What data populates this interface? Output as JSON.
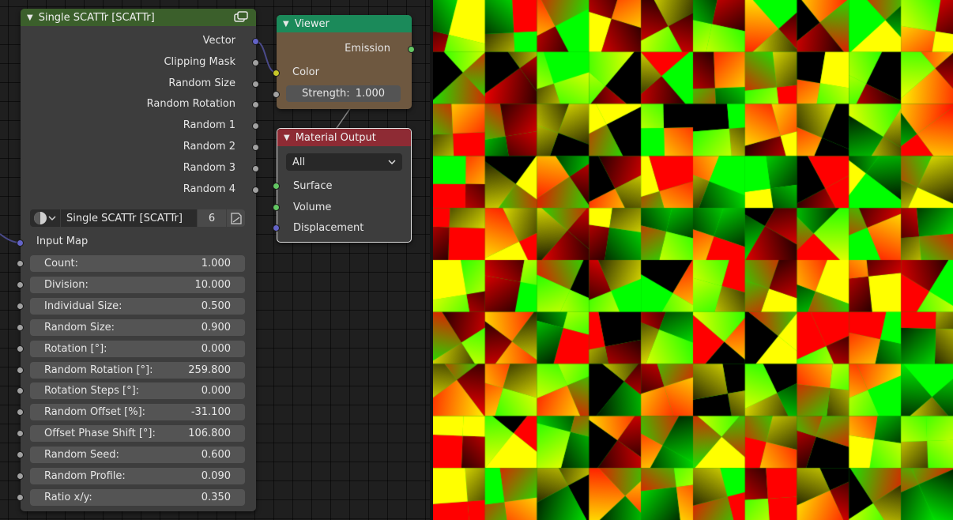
{
  "scatter_node": {
    "title": "Single SCATTr [SCATTr]",
    "outputs": [
      "Vector",
      "Clipping Mask",
      "Random Size",
      "Random Rotation",
      "Random 1",
      "Random 2",
      "Random 3",
      "Random 4"
    ],
    "group_name": "Single SCATTr [SCATTr]",
    "user_count": "6",
    "input_map_label": "Input Map",
    "params": [
      {
        "label": "Count:",
        "value": "1.000"
      },
      {
        "label": "Division:",
        "value": "10.000"
      },
      {
        "label": "Individual Size:",
        "value": "0.500"
      },
      {
        "label": "Random Size:",
        "value": "0.900"
      },
      {
        "label": "Rotation [°]:",
        "value": "0.000"
      },
      {
        "label": "Random Rotation [°]:",
        "value": "259.800"
      },
      {
        "label": "Rotation Steps [°]:",
        "value": "0.000"
      },
      {
        "label": "Random Offset [%]:",
        "value": "-31.100"
      },
      {
        "label": "Offset Phase Shift [°]:",
        "value": "106.800"
      },
      {
        "label": "Random Seed:",
        "value": "0.600"
      },
      {
        "label": "Random Profile:",
        "value": "0.090"
      },
      {
        "label": "Ratio x/y:",
        "value": "0.350"
      }
    ],
    "header_color": "#3b5f2b"
  },
  "viewer_node": {
    "title": "Viewer",
    "output_label": "Emission",
    "color_label": "Color",
    "strength_label": "Strength:",
    "strength_value": "1.000",
    "header_color": "#1b8a5a",
    "body_color": "#6e5840"
  },
  "material_output_node": {
    "title": "Material Output",
    "target": "All",
    "inputs": [
      "Surface",
      "Volume",
      "Displacement"
    ],
    "header_color": "#8e2b34"
  },
  "colors": {
    "red": "#ff0000",
    "yellow": "#ffff00",
    "green": "#00ff00",
    "black": "#000000"
  },
  "icons": {
    "collapse": "triangle-down-icon",
    "node_group": "node-group-icon",
    "shader_ball": "shader-ball-icon",
    "fake_user": "fake-user-icon"
  }
}
